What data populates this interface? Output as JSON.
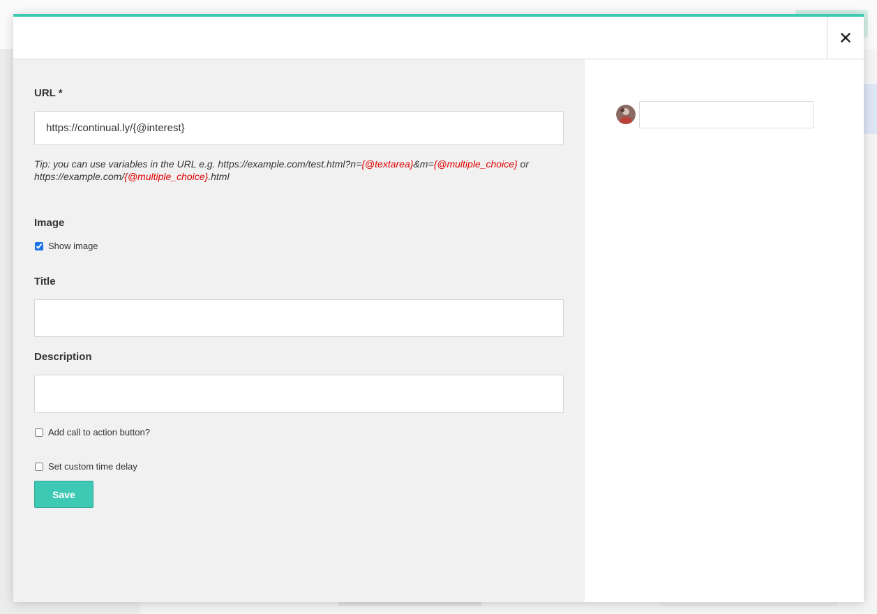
{
  "modal": {
    "accent_color": "#3ec9b5",
    "close_icon": "close-icon"
  },
  "form": {
    "url": {
      "label": "URL *",
      "value": "https://continual.ly/{@interest}"
    },
    "tip": {
      "prefix": "Tip: you can use variables in the URL e.g. https://example.com/test.html?n=",
      "var1": "{@textarea}",
      "mid1": "&m=",
      "var2": "{@multiple_choice}",
      "mid2": " or https://example.com/",
      "var3": "{@multiple_choice}",
      "suffix": ".html"
    },
    "image": {
      "label": "Image",
      "show_image_label": "Show image",
      "show_image_checked": true
    },
    "title": {
      "label": "Title",
      "value": ""
    },
    "description": {
      "label": "Description",
      "value": ""
    },
    "cta": {
      "label": "Add call to action button?",
      "checked": false
    },
    "delay": {
      "label": "Set custom time delay",
      "checked": false
    },
    "save_label": "Save",
    "variable_color": "#e00000"
  },
  "preview": {
    "avatar_icon": "user-avatar",
    "message_value": ""
  }
}
